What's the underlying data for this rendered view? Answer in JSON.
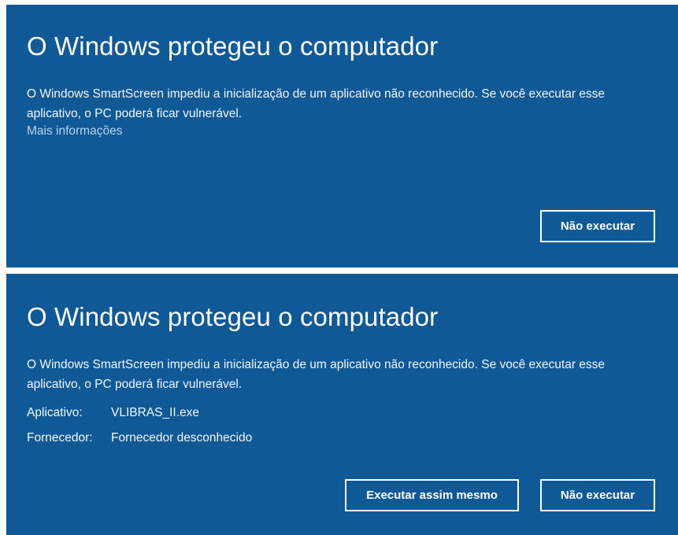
{
  "dialog_collapsed": {
    "title": "O Windows protegeu o computador",
    "message": "O Windows SmartScreen impediu a inicialização de um aplicativo não reconhecido. Se você executar esse aplicativo, o PC poderá ficar vulnerável.",
    "more_info_link": "Mais informações",
    "dont_run_button": "Não executar"
  },
  "dialog_expanded": {
    "title": "O Windows protegeu o computador",
    "message": "O Windows SmartScreen impediu a inicialização de um aplicativo não reconhecido. Se você executar esse aplicativo, o PC poderá ficar vulnerável.",
    "details": {
      "app_label": "Aplicativo:",
      "app_value": "VLIBRAS_II.exe",
      "publisher_label": "Fornecedor:",
      "publisher_value": "Fornecedor desconhecido"
    },
    "run_anyway_button": "Executar assim mesmo",
    "dont_run_button": "Não executar"
  },
  "colors": {
    "panel_background": "#0f5997",
    "text": "#ffffff",
    "link": "#b6d3ef"
  }
}
